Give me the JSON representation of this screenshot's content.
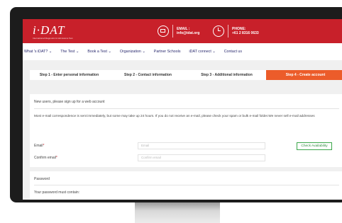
{
  "header": {
    "logo": "i·DAT",
    "logo_sub": "International Diagnostic & Admissions Test",
    "email_label": "EMAIL :",
    "email_value": "info@idat.org",
    "phone_label": "PHONE:",
    "phone_value": "+61 2 8316 0633"
  },
  "nav": {
    "items": [
      "What 's iDAT? ⌄",
      "The Test ⌄",
      "Book a Test ⌄",
      "Organization ⌄",
      "Partner Schools",
      "iDAT connect ⌄",
      "Contact us"
    ]
  },
  "steps": [
    {
      "label": "Step 1 - Enter personal information",
      "active": false
    },
    {
      "label": "Step 2 - Contact information",
      "active": false
    },
    {
      "label": "Step 3 - Additional information",
      "active": false
    },
    {
      "label": "Step 4 - Create account",
      "active": true
    }
  ],
  "form": {
    "intro": "New users, please sign up for a web account",
    "note": "Most e-mail correspondence is sent immediately, but some may take up 24 hours. If you do not receive an e-mail, please check your spam or bulk e-mail folder.We never sell e-mail addresses",
    "email_label": "Email",
    "email_placeholder": "Email",
    "confirm_label": "Confirm email",
    "confirm_placeholder": "Confirm email",
    "required_mark": "*",
    "check_button": "Check Availability"
  },
  "password": {
    "title": "Password",
    "text": "Your password must contain:"
  },
  "colors": {
    "brand_red": "#c8202a",
    "active_step": "#ec5c2a",
    "available_green": "#3aa64a"
  }
}
